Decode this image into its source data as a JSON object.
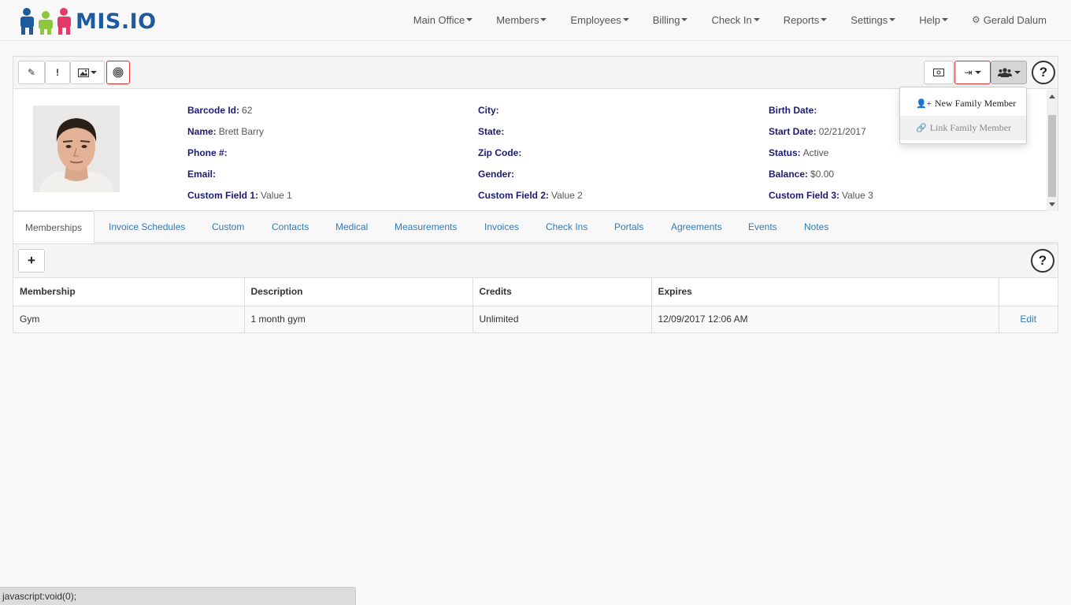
{
  "brand": {
    "logo_text": "MIS.IO",
    "colors": [
      "#1e5b9e",
      "#8dc63f",
      "#e23b6a"
    ]
  },
  "nav": {
    "items": [
      "Main Office",
      "Members",
      "Employees",
      "Billing",
      "Check In",
      "Reports",
      "Settings",
      "Help"
    ],
    "user": "Gerald Dalum"
  },
  "toolbar": {
    "left_icons": [
      "pencil-icon",
      "exclamation-icon",
      "image-icon",
      "fingerprint-icon"
    ],
    "right_icons": [
      "money-icon",
      "sign-out-icon",
      "users-icon",
      "help-icon"
    ],
    "help_label": "?"
  },
  "profile": {
    "col1": [
      {
        "label": "Barcode Id:",
        "value": "62"
      },
      {
        "label": "Name:",
        "value": "Brett Barry"
      },
      {
        "label": "Phone #:",
        "value": ""
      },
      {
        "label": "Email:",
        "value": ""
      },
      {
        "label": "Custom Field 1:",
        "value": "Value 1"
      }
    ],
    "col2": [
      {
        "label": "City:",
        "value": ""
      },
      {
        "label": "State:",
        "value": ""
      },
      {
        "label": "Zip Code:",
        "value": ""
      },
      {
        "label": "Gender:",
        "value": ""
      },
      {
        "label": "Custom Field 2:",
        "value": "Value 2"
      }
    ],
    "col3": [
      {
        "label": "Birth Date:",
        "value": ""
      },
      {
        "label": "Start Date:",
        "value": "02/21/2017"
      },
      {
        "label": "Status:",
        "value": "Active"
      },
      {
        "label": "Balance:",
        "value": "$0.00"
      },
      {
        "label": "Custom Field 3:",
        "value": "Value 3"
      }
    ]
  },
  "family_menu": {
    "items": [
      {
        "label": "New Family Member",
        "icon": "user-plus-icon",
        "disabled": false
      },
      {
        "label": "Link Family Member",
        "icon": "link-icon",
        "disabled": true
      }
    ]
  },
  "tabs": [
    "Memberships",
    "Invoice Schedules",
    "Custom",
    "Contacts",
    "Medical",
    "Measurements",
    "Invoices",
    "Check Ins",
    "Portals",
    "Agreements",
    "Events",
    "Notes"
  ],
  "memberships": {
    "add_label": "+",
    "help_label": "?",
    "columns": [
      "Membership",
      "Description",
      "Credits",
      "Expires",
      ""
    ],
    "rows": [
      {
        "membership": "Gym",
        "description": "1 month gym",
        "credits": "Unlimited",
        "expires": "12/09/2017 12:06 AM",
        "action": "Edit"
      }
    ]
  },
  "status_bar": "javascript:void(0);"
}
